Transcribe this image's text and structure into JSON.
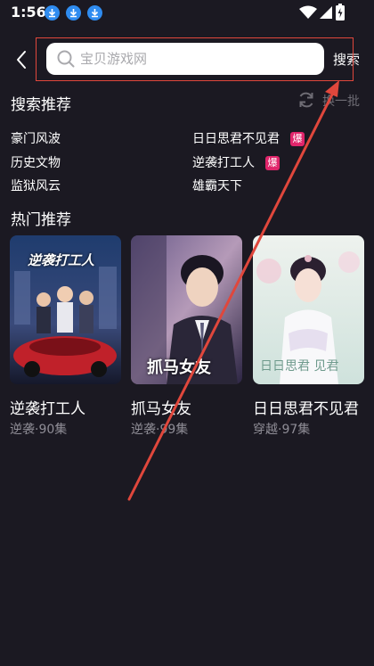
{
  "status_bar": {
    "time": "1:56"
  },
  "search": {
    "placeholder": "宝贝游戏网",
    "button_label": "搜索"
  },
  "recommend": {
    "title": "搜索推荐",
    "refresh_label": "换一批",
    "items": [
      {
        "label": "豪门风波",
        "badge": ""
      },
      {
        "label": "日日思君不见君",
        "badge": "爆"
      },
      {
        "label": "历史文物",
        "badge": ""
      },
      {
        "label": "逆袭打工人",
        "badge": "爆"
      },
      {
        "label": "监狱风云",
        "badge": ""
      },
      {
        "label": "雄霸天下",
        "badge": ""
      }
    ]
  },
  "hot": {
    "title": "热门推荐",
    "cards": [
      {
        "title": "逆袭打工人",
        "meta": "逆袭·90集",
        "poster_text": "逆袭打工人"
      },
      {
        "title": "抓马女友",
        "meta": "逆袭·99集",
        "poster_text": "抓马女友"
      },
      {
        "title": "日日思君不见君",
        "meta": "穿越·97集",
        "poster_text": "日日思君 见君"
      }
    ]
  },
  "colors": {
    "background": "#1b1922",
    "accent_badge": "#e0256b",
    "annotation": "#e0473c"
  }
}
